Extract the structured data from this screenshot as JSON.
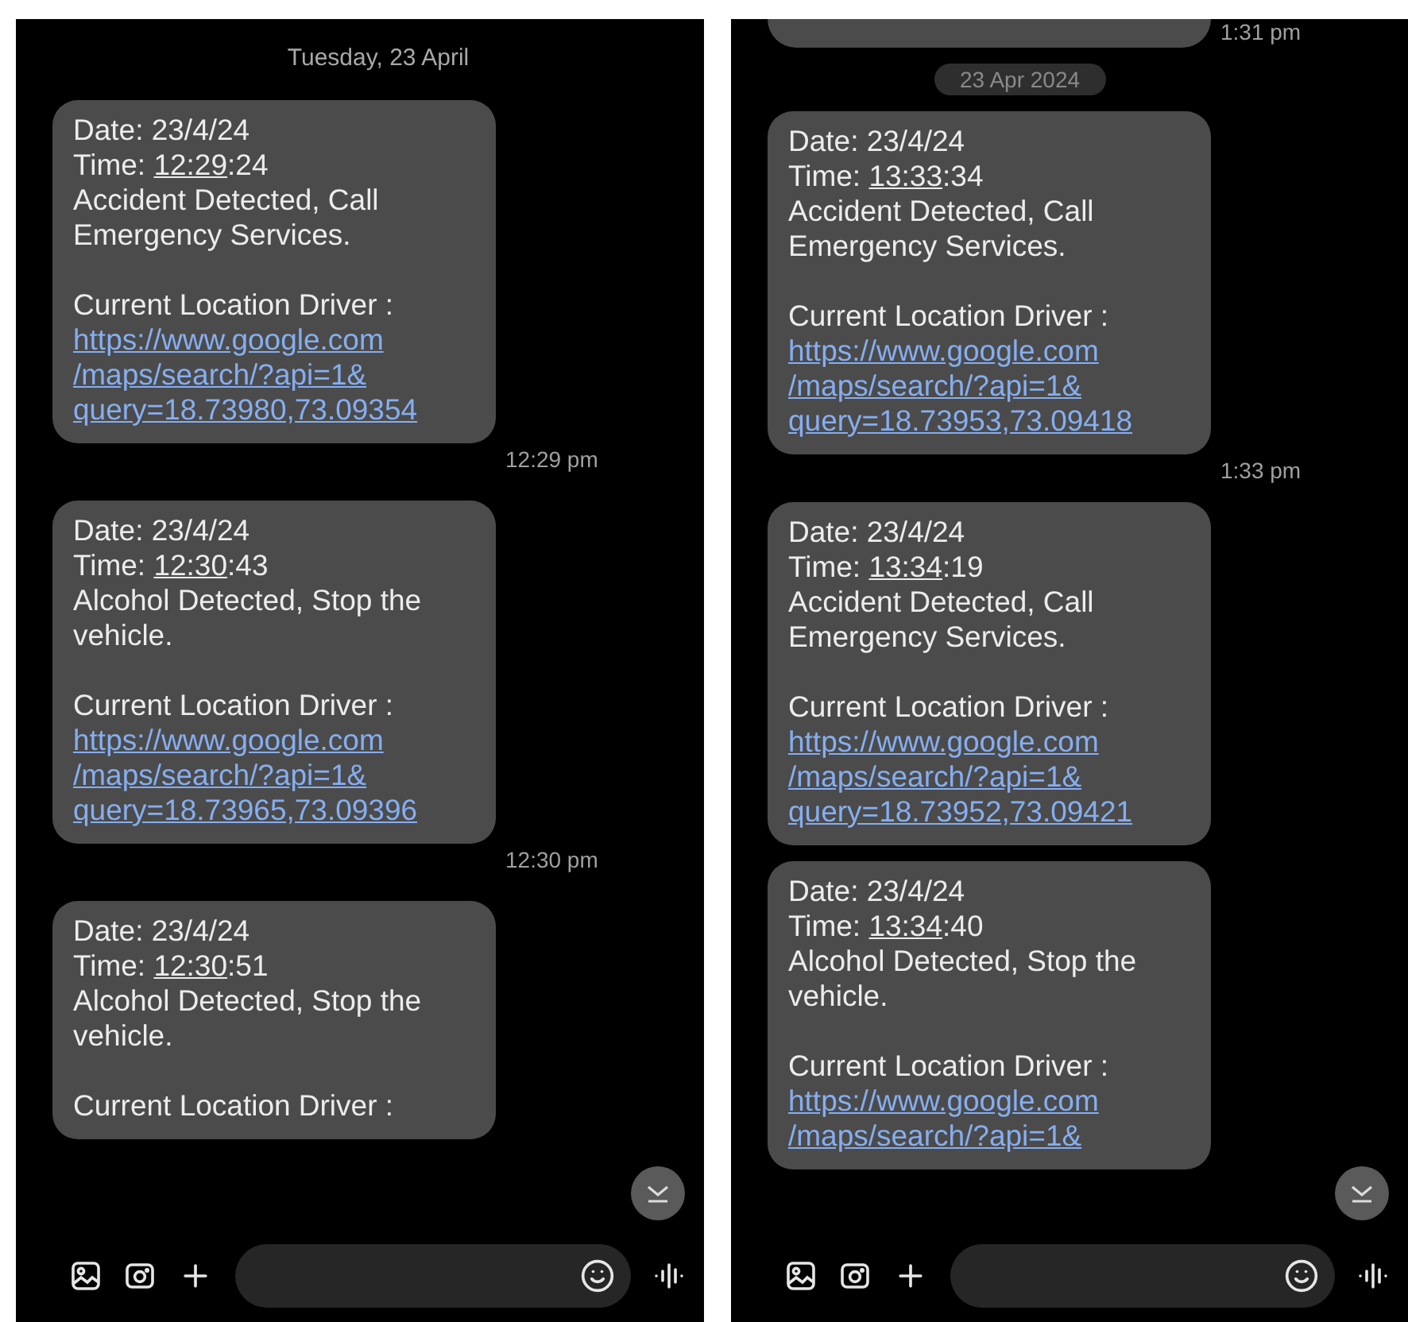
{
  "panels": [
    {
      "items": [
        {
          "kind": "date_header",
          "text": "Tuesday, 23 April"
        },
        {
          "kind": "message",
          "date": "Date: 23/4/24",
          "time_label": "Time:",
          "time_link": "12:29",
          "time_rest": ":24",
          "alert": "Accident Detected, Call Emergency Services.",
          "location_label": "Current Location Driver :",
          "link_lines": [
            "https://www.google.com",
            "/maps/search/?api=1&",
            "query=18.73980,73.09354"
          ],
          "time": "12:29 pm"
        },
        {
          "kind": "message",
          "date": "Date: 23/4/24",
          "time_label": "Time:",
          "time_link": "12:30",
          "time_rest": ":43",
          "alert": "Alcohol Detected, Stop the vehicle.",
          "location_label": "Current Location Driver :",
          "link_lines": [
            "https://www.google.com",
            "/maps/search/?api=1&",
            "query=18.73965,73.09396"
          ],
          "time": "12:30 pm"
        },
        {
          "kind": "message",
          "date": "Date: 23/4/24",
          "time_label": "Time:",
          "time_link": "12:30",
          "time_rest": ":51",
          "alert": "Alcohol Detected, Stop the vehicle.",
          "location_label": "Current Location Driver :"
        }
      ]
    },
    {
      "items": [
        {
          "kind": "partial_message",
          "time": "1:31 pm"
        },
        {
          "kind": "date_chip",
          "text": "23 Apr 2024"
        },
        {
          "kind": "message",
          "date": "Date: 23/4/24",
          "time_label": "Time:",
          "time_link": "13:33",
          "time_rest": ":34",
          "alert": "Accident Detected, Call Emergency Services.",
          "location_label": "Current Location Driver :",
          "link_lines": [
            "https://www.google.com",
            "/maps/search/?api=1&",
            "query=18.73953,73.09418"
          ],
          "time": "1:33 pm"
        },
        {
          "kind": "message",
          "date": "Date: 23/4/24",
          "time_label": "Time:",
          "time_link": "13:34",
          "time_rest": ":19",
          "alert": "Accident Detected, Call Emergency Services.",
          "location_label": "Current Location Driver :",
          "link_lines": [
            "https://www.google.com",
            "/maps/search/?api=1&",
            "query=18.73952,73.09421"
          ]
        },
        {
          "kind": "message",
          "date": "Date: 23/4/24",
          "time_label": "Time:",
          "time_link": "13:34",
          "time_rest": ":40",
          "alert": "Alcohol Detected, Stop the vehicle.",
          "location_label": "Current Location Driver :",
          "link_lines": [
            "https://www.google.com",
            "/maps/search/?api=1&"
          ]
        }
      ]
    }
  ]
}
